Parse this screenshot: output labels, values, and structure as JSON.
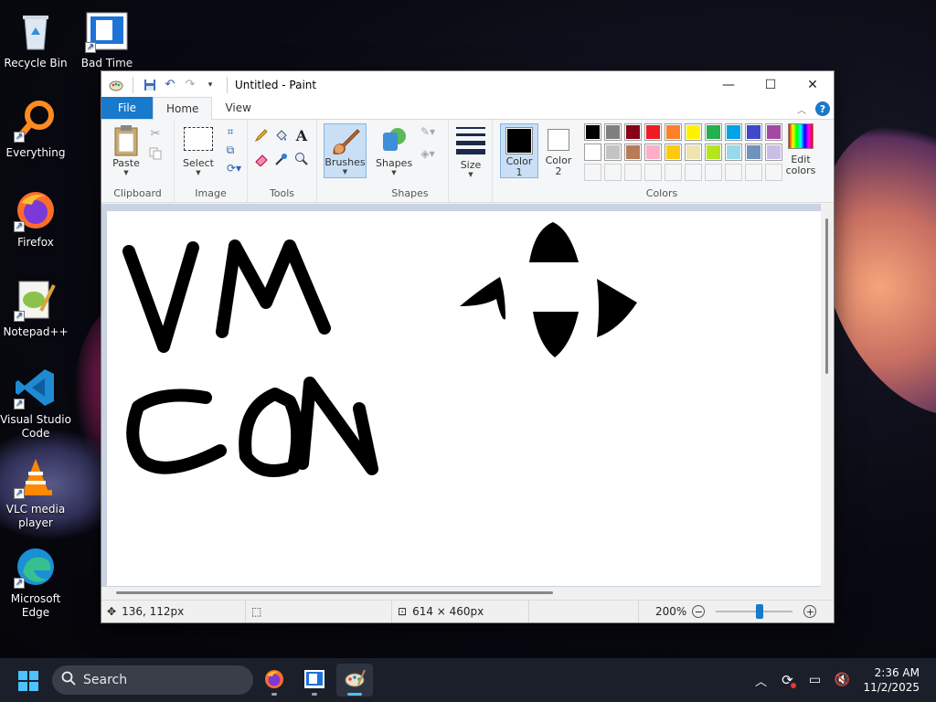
{
  "desktop": {
    "icons": [
      {
        "label": "Recycle Bin",
        "icon": "recycle-bin-icon"
      },
      {
        "label": "Bad Time",
        "icon": "bad-time-shortcut-icon"
      },
      {
        "label": "Everything",
        "icon": "everything-search-icon"
      },
      {
        "label": "Firefox",
        "icon": "firefox-icon"
      },
      {
        "label": "Notepad++",
        "icon": "notepadpp-icon"
      },
      {
        "label": "Visual Studio Code",
        "icon": "vscode-icon"
      },
      {
        "label": "VLC media player",
        "icon": "vlc-icon"
      },
      {
        "label": "Microsoft Edge",
        "icon": "edge-icon"
      }
    ]
  },
  "window": {
    "title": "Untitled - Paint",
    "tabs": {
      "file": "File",
      "home": "Home",
      "view": "View"
    },
    "help": "?"
  },
  "ribbon": {
    "clipboard": {
      "paste": "Paste",
      "group": "Clipboard"
    },
    "image": {
      "select": "Select",
      "group": "Image"
    },
    "tools": {
      "group": "Tools",
      "text_glyph": "A"
    },
    "brushes": {
      "label": "Brushes"
    },
    "shapes": {
      "label": "Shapes",
      "group": "Shapes"
    },
    "size": {
      "label": "Size"
    },
    "colors": {
      "color1_label": "Color",
      "color1_num": "1",
      "color2_label": "Color",
      "color2_num": "2",
      "edit_label": "Edit",
      "edit_label2": "colors",
      "group": "Colors",
      "color1": "#000000",
      "color2": "#ffffff",
      "row1": [
        "#000000",
        "#7f7f7f",
        "#880015",
        "#ed1c24",
        "#ff7f27",
        "#fff200",
        "#22b14c",
        "#00a2e8",
        "#3f48cc",
        "#a349a4"
      ],
      "row2": [
        "#ffffff",
        "#c3c3c3",
        "#b97a57",
        "#ffaec9",
        "#ffc90e",
        "#efe4b0",
        "#b5e61d",
        "#99d9ea",
        "#7092be",
        "#c8bfe7"
      ]
    }
  },
  "statusbar": {
    "cursor_pos": "136, 112px",
    "image_size": "614 × 460px",
    "zoom": "200%"
  },
  "taskbar": {
    "search_placeholder": "Search",
    "time": "2:36 AM",
    "date": "11/2/2025"
  }
}
